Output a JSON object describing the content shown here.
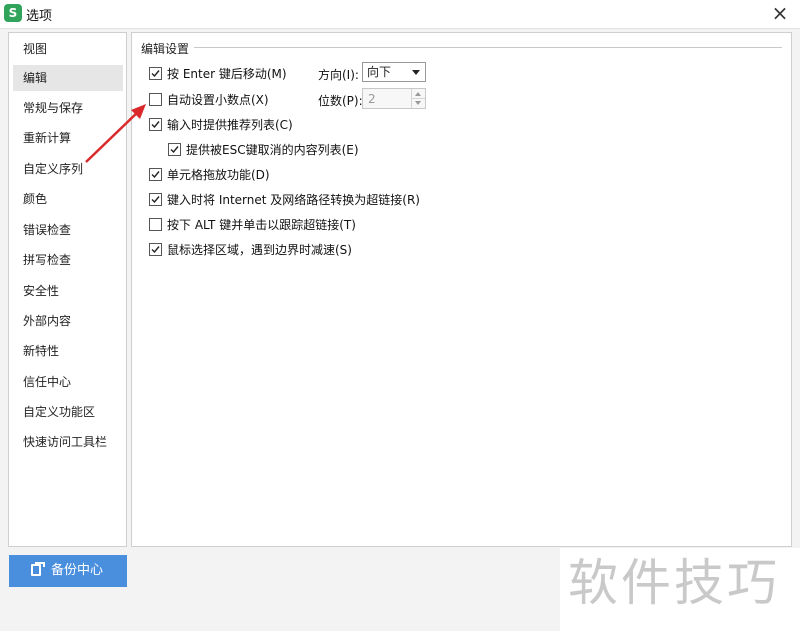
{
  "window": {
    "title": "选项",
    "app_icon": "S"
  },
  "sidebar": {
    "items": [
      {
        "label": "视图"
      },
      {
        "label": "编辑",
        "active": true
      },
      {
        "label": "常规与保存"
      },
      {
        "label": "重新计算"
      },
      {
        "label": "自定义序列"
      },
      {
        "label": "颜色"
      },
      {
        "label": "错误检查"
      },
      {
        "label": "拼写检查"
      },
      {
        "label": "安全性"
      },
      {
        "label": "外部内容"
      },
      {
        "label": "新特性"
      },
      {
        "label": "信任中心"
      },
      {
        "label": "自定义功能区"
      },
      {
        "label": "快速访问工具栏"
      }
    ]
  },
  "edit_settings": {
    "group_title": "编辑设置",
    "options": [
      {
        "label": "按 Enter 键后移动(M)",
        "checked": true
      },
      {
        "label": "自动设置小数点(X)",
        "checked": false
      },
      {
        "label": "输入时提供推荐列表(C)",
        "checked": true
      },
      {
        "label": "提供被ESC键取消的内容列表(E)",
        "checked": true
      },
      {
        "label": "单元格拖放功能(D)",
        "checked": true
      },
      {
        "label": "键入时将 Internet 及网络路径转换为超链接(R)",
        "checked": true
      },
      {
        "label": "按下 ALT 键并单击以跟踪超链接(T)",
        "checked": false
      },
      {
        "label": "鼠标选择区域，遇到边界时减速(S)",
        "checked": true
      }
    ],
    "direction": {
      "label": "方向(I):",
      "value": "向下"
    },
    "decimal_places": {
      "label": "位数(P):",
      "value": "2"
    }
  },
  "footer": {
    "backup_label": "备份中心"
  },
  "watermark": "软件技巧",
  "colors": {
    "accent": "#4a8ede",
    "annotation_arrow": "#d9292b",
    "app_icon": "#2fa45a"
  }
}
